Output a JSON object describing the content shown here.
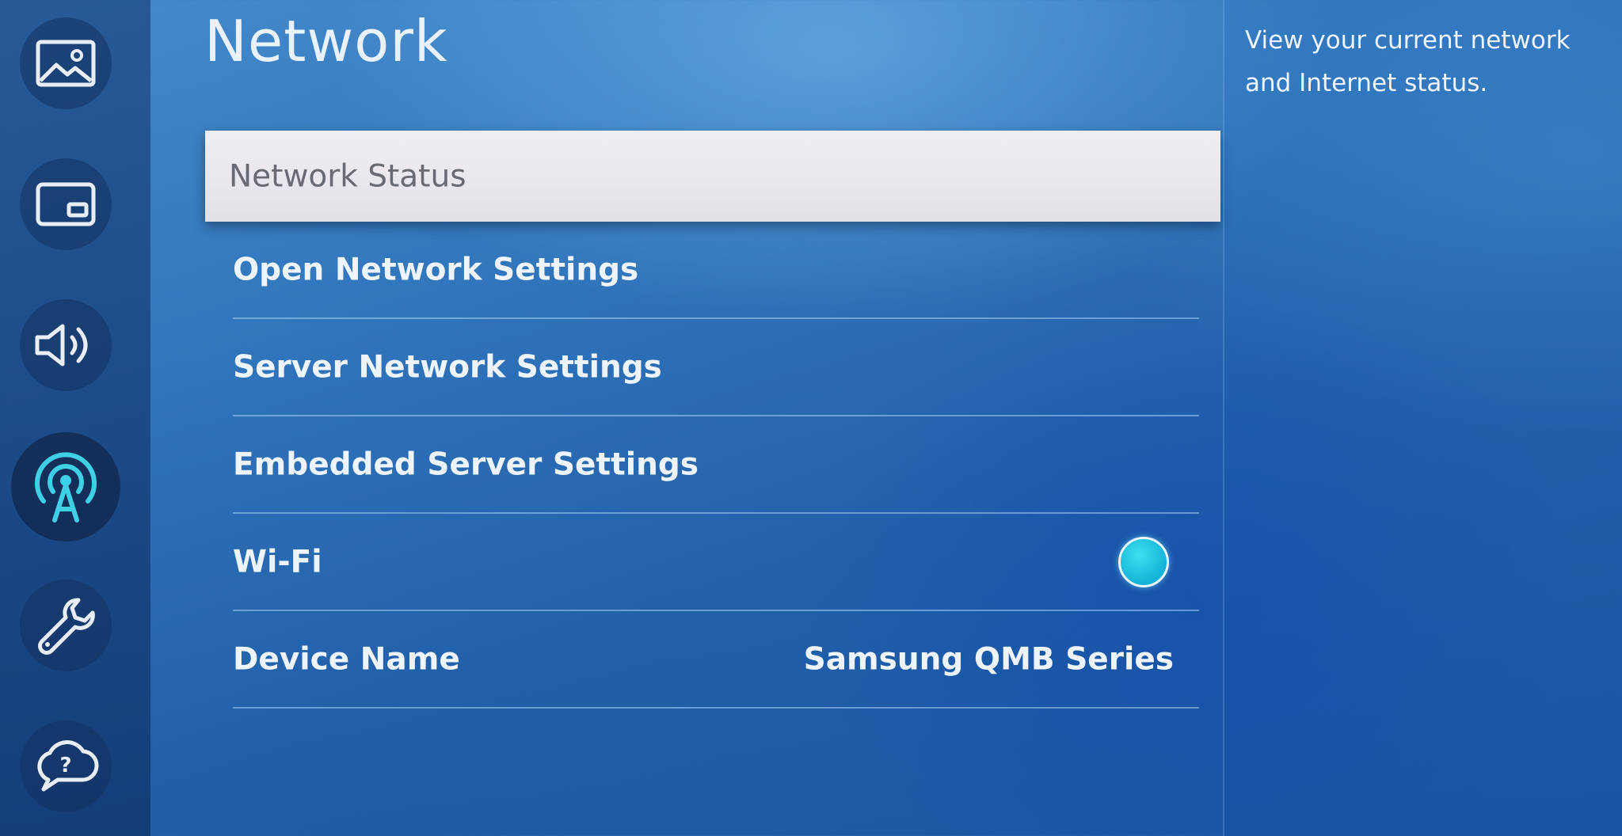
{
  "rail": {
    "items": [
      {
        "icon": "picture-icon",
        "label": ""
      },
      {
        "icon": "screen-icon",
        "label": ""
      },
      {
        "icon": "sound-icon",
        "label": ""
      },
      {
        "icon": "network-icon",
        "label": "",
        "active": true
      },
      {
        "icon": "wrench-icon",
        "label": ""
      },
      {
        "icon": "support-cloud-icon",
        "label": ""
      }
    ],
    "accent_color": "#3fd0e6"
  },
  "main": {
    "title": "Network",
    "items": [
      {
        "label": "Network Status",
        "selected": true
      },
      {
        "label": "Open Network Settings"
      },
      {
        "label": "Server Network Settings"
      },
      {
        "label": "Embedded Server Settings"
      },
      {
        "label": "Wi-Fi",
        "toggle": "on"
      },
      {
        "label": "Device Name",
        "value": "Samsung QMB Series"
      }
    ]
  },
  "description": {
    "text": "View your current network and Internet status."
  },
  "colors": {
    "background": "#2a6fb8",
    "selected_bg": "#ece9ef",
    "toggle_on": "#1cc0e0"
  }
}
